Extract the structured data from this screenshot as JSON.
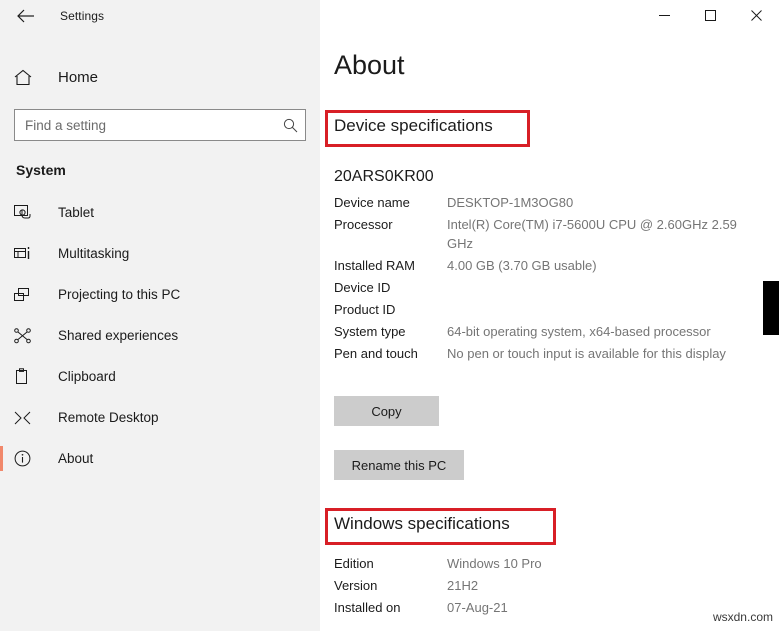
{
  "window": {
    "app_title": "Settings",
    "back_icon": "back-arrow-icon",
    "minimize_label": "─",
    "maximize_label": "□",
    "close_label": "✕"
  },
  "sidebar": {
    "home_label": "Home",
    "home_icon": "home-icon",
    "search": {
      "placeholder": "Find a setting",
      "value": "",
      "icon": "search-icon"
    },
    "section_title": "System",
    "items": [
      {
        "label": "Tablet",
        "icon": "tablet-icon",
        "selected": false
      },
      {
        "label": "Multitasking",
        "icon": "multitasking-icon",
        "selected": false
      },
      {
        "label": "Projecting to this PC",
        "icon": "projecting-icon",
        "selected": false
      },
      {
        "label": "Shared experiences",
        "icon": "shared-experiences-icon",
        "selected": false
      },
      {
        "label": "Clipboard",
        "icon": "clipboard-icon",
        "selected": false
      },
      {
        "label": "Remote Desktop",
        "icon": "remote-desktop-icon",
        "selected": false
      },
      {
        "label": "About",
        "icon": "info-circle-icon",
        "selected": true
      }
    ]
  },
  "main": {
    "page_title": "About",
    "device_specifications": {
      "heading": "Device specifications",
      "model": "20ARS0KR00",
      "rows": [
        {
          "label": "Device name",
          "value": "DESKTOP-1M3OG80",
          "redacted": false
        },
        {
          "label": "Processor",
          "value": "Intel(R) Core(TM) i7-5600U CPU @ 2.60GHz   2.59 GHz",
          "redacted": false
        },
        {
          "label": "Installed RAM",
          "value": "4.00 GB (3.70 GB usable)",
          "redacted": false
        },
        {
          "label": "Device ID",
          "value": "",
          "redacted": true
        },
        {
          "label": "Product ID",
          "value": "",
          "redacted": true
        },
        {
          "label": "System type",
          "value": "64-bit operating system, x64-based processor",
          "redacted": false
        },
        {
          "label": "Pen and touch",
          "value": "No pen or touch input is available for this display",
          "redacted": false
        }
      ],
      "copy_button": "Copy",
      "rename_button": "Rename this PC"
    },
    "windows_specifications": {
      "heading": "Windows specifications",
      "rows": [
        {
          "label": "Edition",
          "value": "Windows 10 Pro"
        },
        {
          "label": "Version",
          "value": "21H2"
        },
        {
          "label": "Installed on",
          "value": "07-Aug-21"
        }
      ]
    }
  },
  "watermark": "wsxdn.com",
  "colors": {
    "accent_selected": "#f1886b",
    "annotation_red": "#d81f26",
    "sidebar_bg": "#f2f2f2",
    "button_bg": "#cccccc",
    "value_text": "#757575"
  }
}
